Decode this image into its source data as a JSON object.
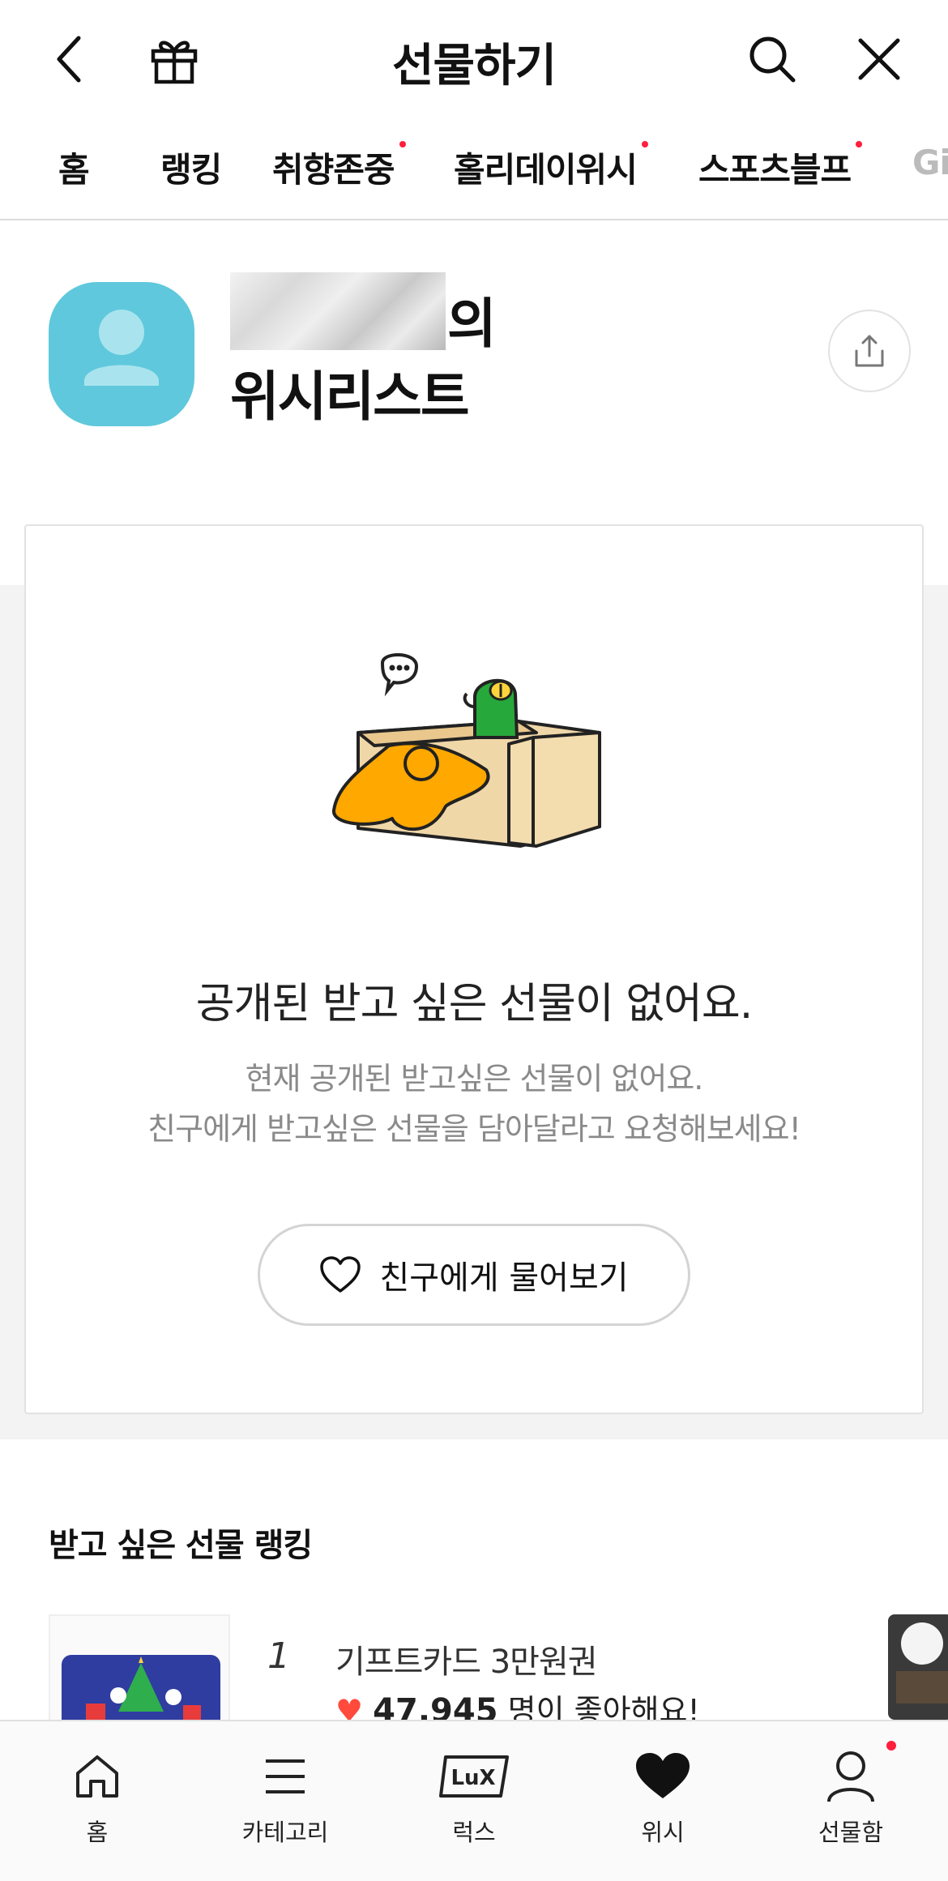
{
  "header": {
    "title": "선물하기",
    "icons": [
      "back-icon",
      "gift-icon",
      "search-icon",
      "close-icon"
    ]
  },
  "tabs": [
    {
      "label": "홈",
      "dot": false
    },
    {
      "label": "랭킹",
      "dot": false
    },
    {
      "label": "취향존중",
      "dot": true
    },
    {
      "label": "홀리데이위시",
      "dot": true
    },
    {
      "label": "스포츠블프",
      "dot": true
    },
    {
      "label": "Gi",
      "dot": false
    }
  ],
  "profile": {
    "name_suffix": "의",
    "wishlist_title": "위시리스트"
  },
  "empty_state": {
    "title": "공개된 받고 싶은 선물이 없어요.",
    "desc_line1": "현재 공개된 받고싶은 선물이 없어요.",
    "desc_line2": "친구에게 받고싶은 선물을 담아달라고 요청해보세요!",
    "button_label": "친구에게 물어보기"
  },
  "ranking": {
    "heading": "받고 싶은 선물 랭킹",
    "items": [
      {
        "rank": "1",
        "name": "기프트카드 3만원권",
        "likes": "47,945",
        "likes_suffix": "명이 좋아해요!"
      }
    ]
  },
  "bottom_nav": {
    "items": [
      {
        "label": "홈",
        "icon": "home-icon"
      },
      {
        "label": "카테고리",
        "icon": "menu-icon"
      },
      {
        "label": "럭스",
        "icon": "lux-icon"
      },
      {
        "label": "위시",
        "icon": "heart-icon"
      },
      {
        "label": "선물함",
        "icon": "person-icon"
      }
    ],
    "active": "위시"
  },
  "colors": {
    "accent_dot": "#ff1e3c",
    "highlight": "#fff36b",
    "avatar_bg": "#5fc8dc",
    "heart": "#ff4a3c"
  }
}
